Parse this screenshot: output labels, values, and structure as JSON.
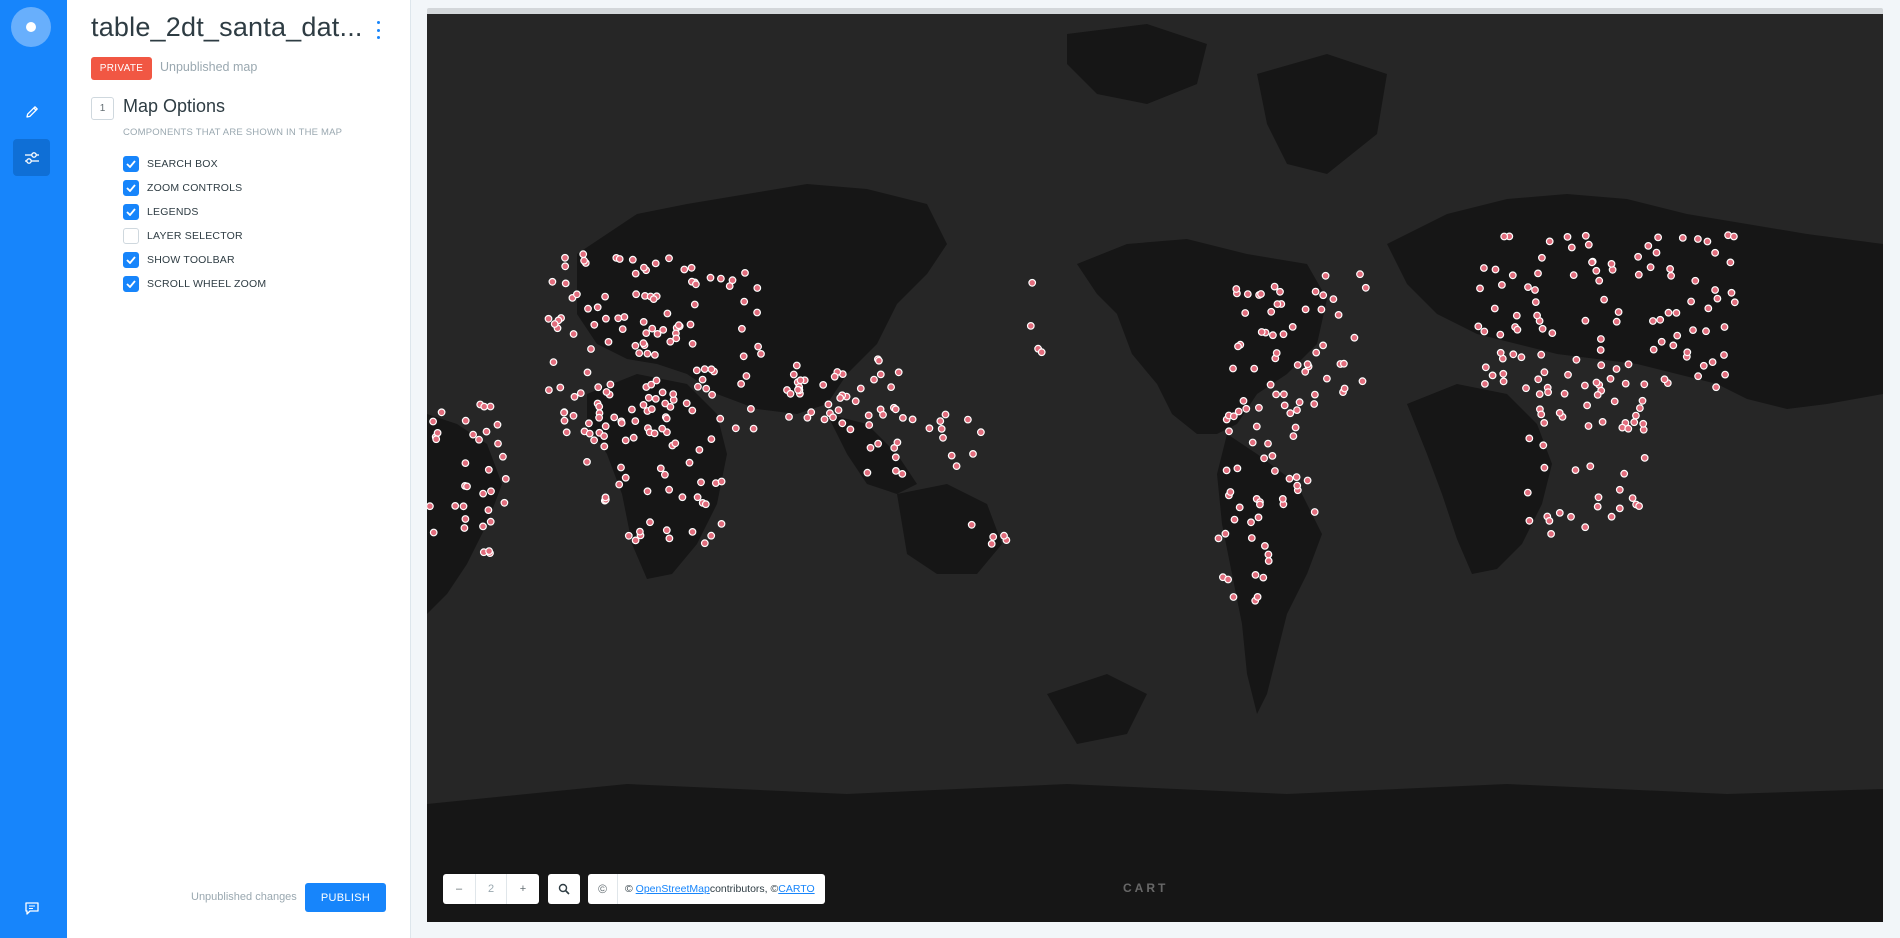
{
  "rail": {
    "logo_icon": "carto-logo-icon",
    "edit_icon": "pencil-icon",
    "settings_icon": "sliders-icon",
    "feedback_icon": "chat-icon",
    "accent": "#1785fb"
  },
  "header": {
    "title": "table_2dt_santa_dat...",
    "privacy_label": "PRIVATE",
    "privacy_color": "#f15743",
    "publish_state": "Unpublished map"
  },
  "map_options": {
    "step": "1",
    "title": "Map Options",
    "subtitle": "COMPONENTS THAT ARE SHOWN IN THE MAP",
    "options": [
      {
        "label": "SEARCH BOX",
        "checked": true
      },
      {
        "label": "ZOOM CONTROLS",
        "checked": true
      },
      {
        "label": "LEGENDS",
        "checked": true
      },
      {
        "label": "LAYER SELECTOR",
        "checked": false
      },
      {
        "label": "SHOW TOOLBAR",
        "checked": true
      },
      {
        "label": "SCROLL WHEEL ZOOM",
        "checked": true
      }
    ]
  },
  "footer": {
    "changes_label": "Unpublished changes",
    "publish_label": "PUBLISH"
  },
  "map": {
    "zoom_out": "–",
    "zoom_level": "2",
    "zoom_in": "+",
    "search_icon": "search-icon",
    "attribution_icon": "©",
    "attribution_prefix": "© ",
    "osm_link": "OpenStreetMap",
    "attribution_mid": " contributors, © ",
    "carto_link": "CARTO",
    "watermark": "CART",
    "basemap_color": "#262626",
    "point_color": "#e26d7d"
  }
}
